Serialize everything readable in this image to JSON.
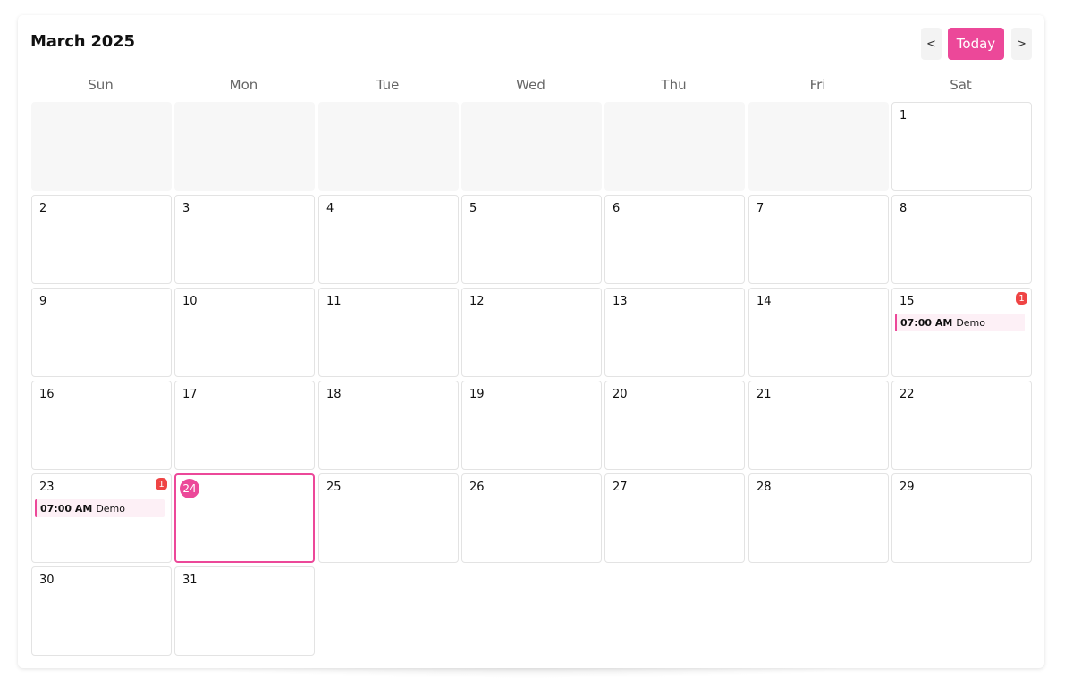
{
  "header": {
    "title": "March 2025",
    "prev_label": "<",
    "today_label": "Today",
    "next_label": ">"
  },
  "colors": {
    "accent": "#ec4899",
    "badge": "#ef4444",
    "event_bg": "#fdf0f6"
  },
  "weekdays": [
    "Sun",
    "Mon",
    "Tue",
    "Wed",
    "Thu",
    "Fri",
    "Sat"
  ],
  "calendar": {
    "leading_empty_days": 6,
    "days": [
      {
        "day": "1"
      },
      {
        "day": "2"
      },
      {
        "day": "3"
      },
      {
        "day": "4"
      },
      {
        "day": "5"
      },
      {
        "day": "6"
      },
      {
        "day": "7"
      },
      {
        "day": "8"
      },
      {
        "day": "9"
      },
      {
        "day": "10"
      },
      {
        "day": "11"
      },
      {
        "day": "12"
      },
      {
        "day": "13"
      },
      {
        "day": "14"
      },
      {
        "day": "15",
        "badge": "1",
        "events": [
          {
            "time": "07:00 AM",
            "title": "Demo"
          }
        ]
      },
      {
        "day": "16"
      },
      {
        "day": "17"
      },
      {
        "day": "18"
      },
      {
        "day": "19"
      },
      {
        "day": "20"
      },
      {
        "day": "21"
      },
      {
        "day": "22"
      },
      {
        "day": "23",
        "badge": "1",
        "events": [
          {
            "time": "07:00 AM",
            "title": "Demo"
          }
        ]
      },
      {
        "day": "24",
        "today": true
      },
      {
        "day": "25"
      },
      {
        "day": "26"
      },
      {
        "day": "27"
      },
      {
        "day": "28"
      },
      {
        "day": "29"
      },
      {
        "day": "30"
      },
      {
        "day": "31"
      }
    ]
  }
}
